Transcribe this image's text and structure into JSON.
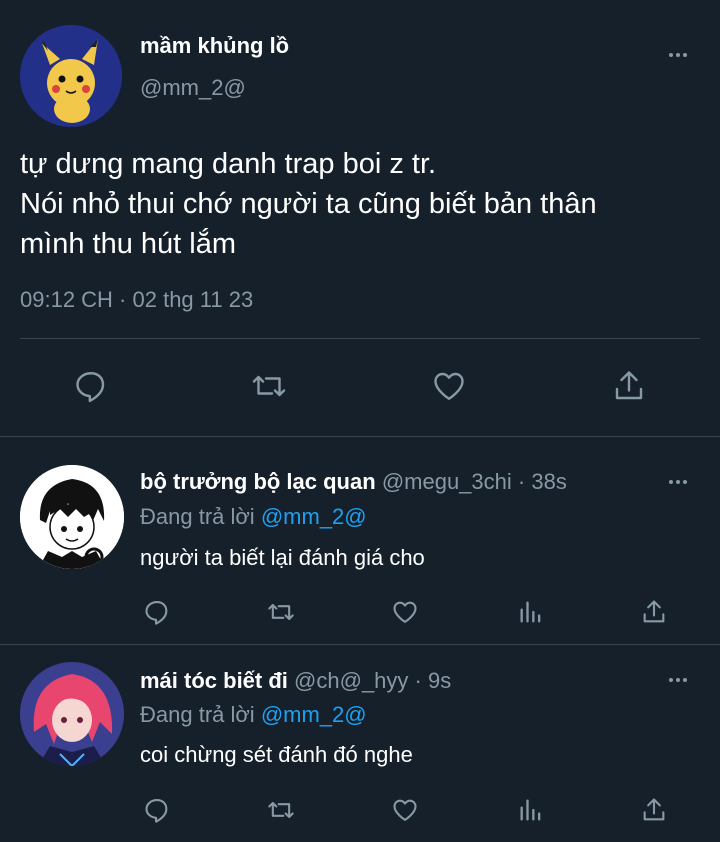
{
  "main_tweet": {
    "display_name": "mầm khủng lồ",
    "handle": "@mm_2@",
    "text_lines": [
      "tự dưng mang danh trap boi z tr.",
      "Nói nhỏ thui chớ người ta cũng biết bản thân",
      "mình thu hút lắm"
    ],
    "timestamp": "09:12 CH · 02 thg 11 23"
  },
  "replies": [
    {
      "display_name": "bộ trưởng bộ lạc quan",
      "handle": "@megu_3chi",
      "time": "· 38s",
      "replying_prefix": "Đang trả lời",
      "replying_to": "@mm_2@",
      "text": "người ta biết lại đánh giá cho"
    },
    {
      "display_name": "mái tóc biết đi",
      "handle": "@ch@_hyy",
      "time": "· 9s",
      "replying_prefix": "Đang trả lời",
      "replying_to": "@mm_2@",
      "text": "coi chừng sét đánh đó nghe"
    }
  ],
  "icons": {
    "reply": "reply-icon",
    "retweet": "retweet-icon",
    "like": "heart-icon",
    "analytics": "analytics-icon",
    "share": "share-icon",
    "more": "more-icon"
  },
  "colors": {
    "background": "#15202b",
    "muted": "#8899a6",
    "accent": "#1da1f2",
    "divider": "#38444d"
  }
}
